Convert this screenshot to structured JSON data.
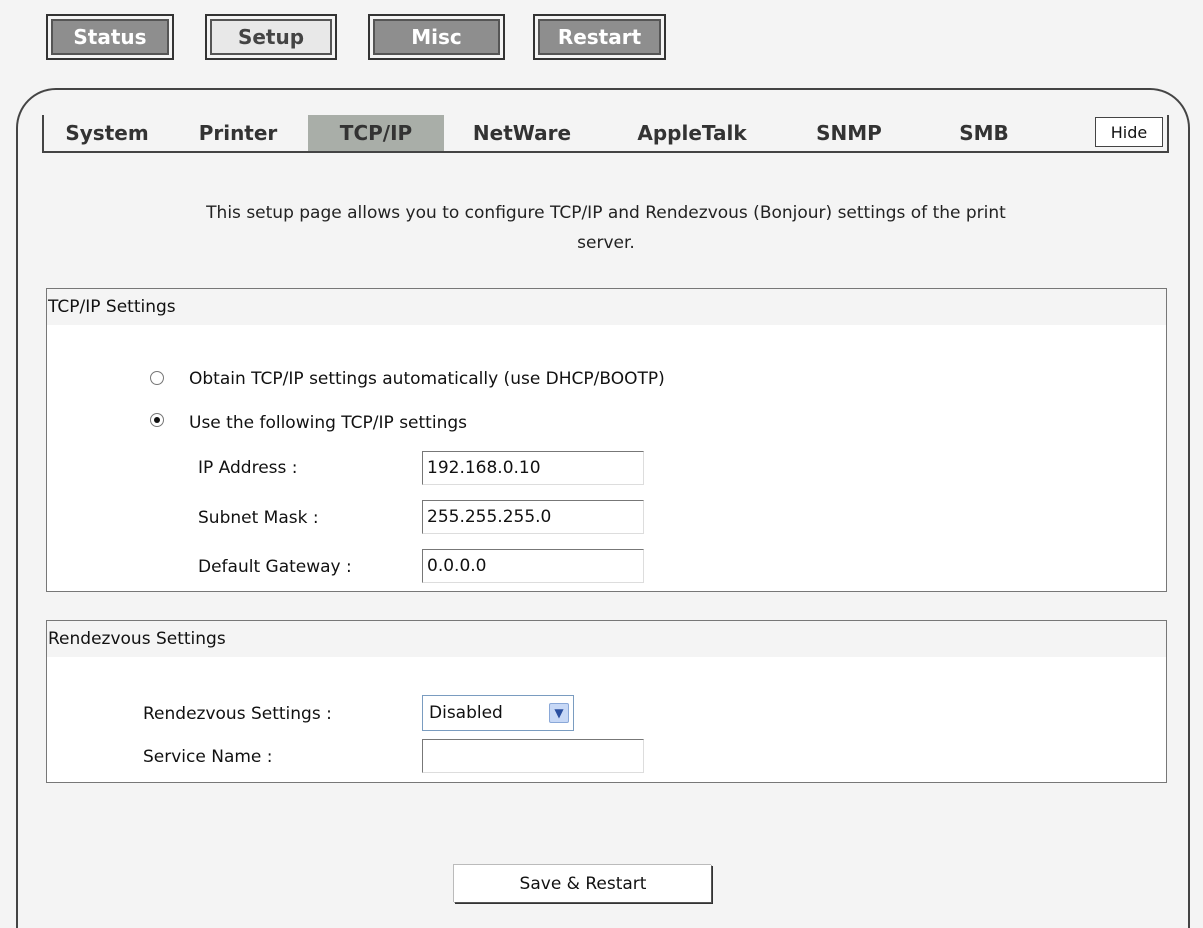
{
  "top_nav": [
    {
      "label": "Status",
      "active": false
    },
    {
      "label": "Setup",
      "active": true
    },
    {
      "label": "Misc",
      "active": false
    },
    {
      "label": "Restart",
      "active": false
    }
  ],
  "tabs": [
    {
      "label": "System",
      "active": false
    },
    {
      "label": "Printer",
      "active": false
    },
    {
      "label": "TCP/IP",
      "active": true
    },
    {
      "label": "NetWare",
      "active": false
    },
    {
      "label": "AppleTalk",
      "active": false
    },
    {
      "label": "SNMP",
      "active": false
    },
    {
      "label": "SMB",
      "active": false
    }
  ],
  "hide_label": "Hide",
  "intro_line1": "This setup page allows you to configure TCP/IP and Rendezvous (Bonjour) settings of the print",
  "intro_line2": "server.",
  "tcpip": {
    "title": "TCP/IP Settings",
    "option_auto": "Obtain TCP/IP settings automatically (use DHCP/BOOTP)",
    "option_manual": "Use the following TCP/IP settings",
    "selected": "manual",
    "ip_label": "IP Address :",
    "ip_value": "192.168.0.10",
    "mask_label": "Subnet Mask :",
    "mask_value": "255.255.255.0",
    "gateway_label": "Default Gateway :",
    "gateway_value": "0.0.0.0"
  },
  "rendezvous": {
    "title": "Rendezvous Settings",
    "settings_label": "Rendezvous Settings :",
    "settings_value": "Disabled",
    "service_label": "Service Name :",
    "service_value": ""
  },
  "save_label": "Save & Restart",
  "colors": {
    "tab_active": "#a9aea8",
    "nav_button": "#8e8e8e",
    "background": "#f4f4f4"
  }
}
